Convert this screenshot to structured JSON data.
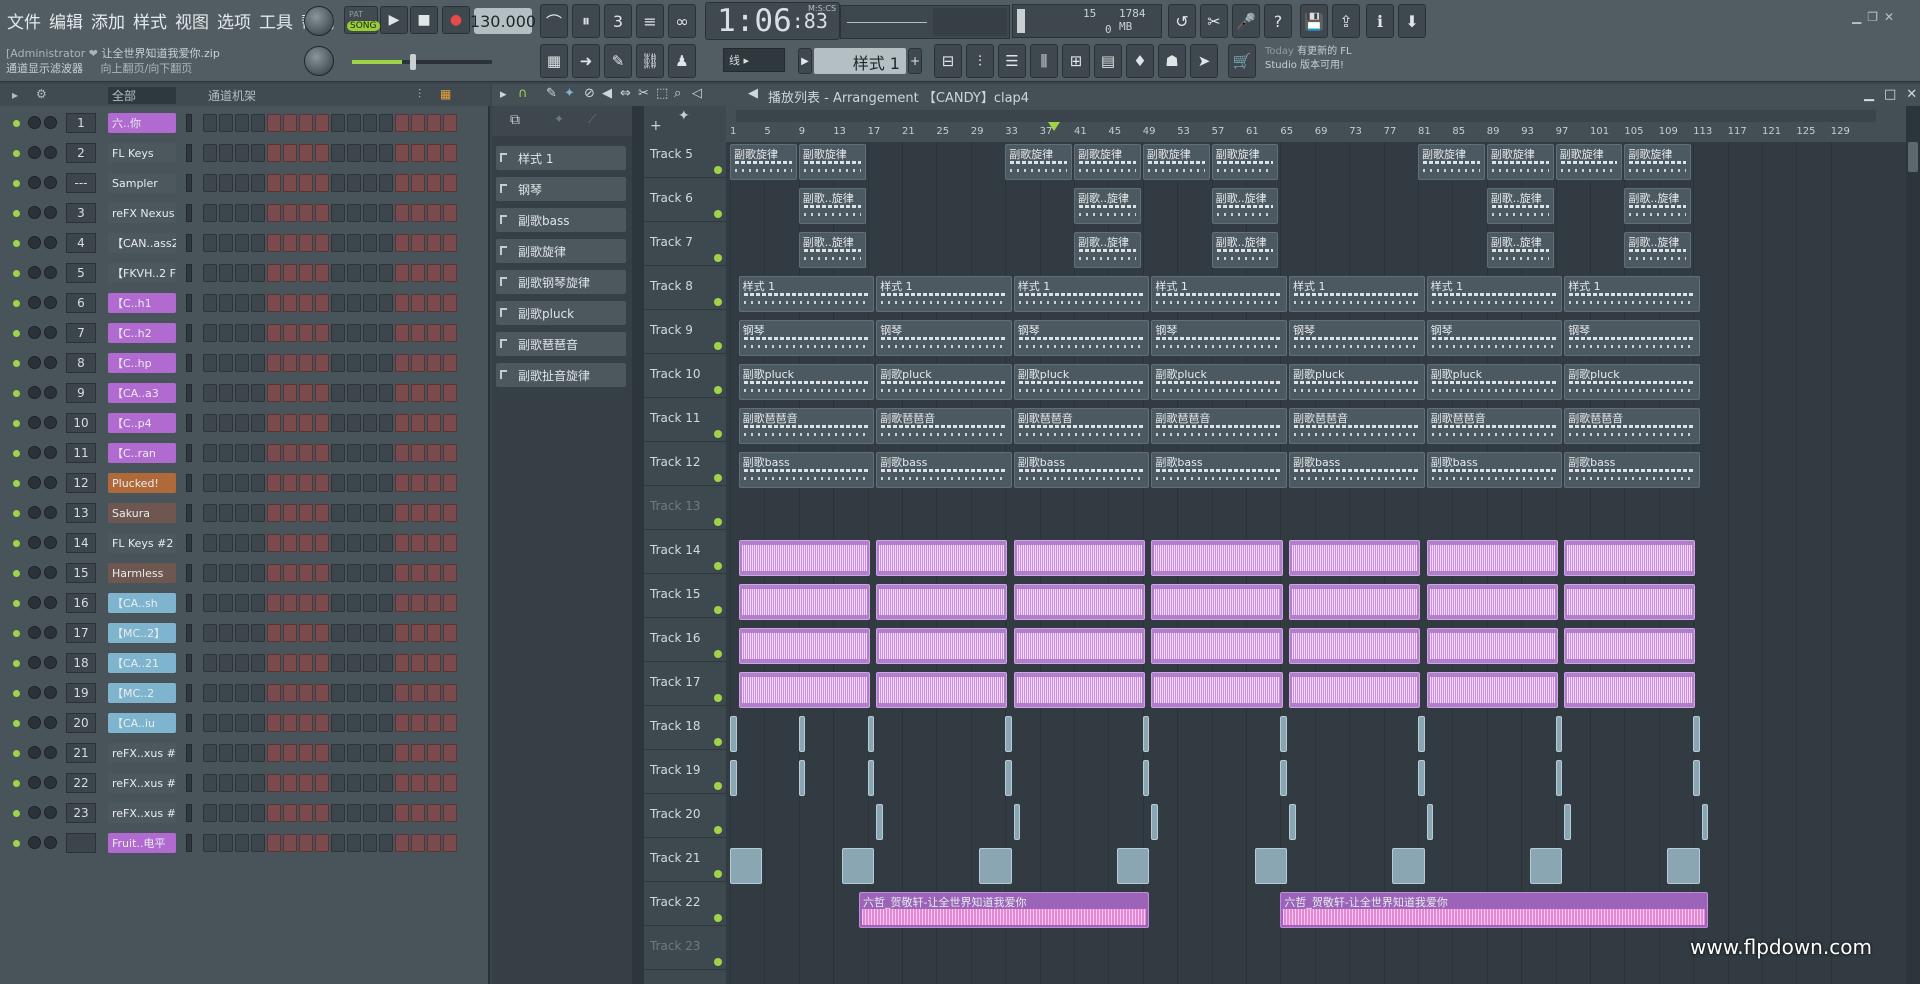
{
  "menu": [
    "文件",
    "编辑",
    "添加",
    "样式",
    "视图",
    "选项",
    "工具",
    "帮助"
  ],
  "hint": {
    "user": "[Administrator ❤",
    "file": "让全世界知道我爱你.zip",
    "line1": "通道显示滤波器",
    "line2": "向上翻页/向下翻页"
  },
  "transport": {
    "pat_label": "PAT",
    "song_label": "SONG",
    "tempo": "130.000",
    "time_main": "1:06",
    "time_sub": ":83",
    "time_unit": "M:S:CS"
  },
  "cpu": {
    "voices": "15",
    "mem": "1784 MB",
    "zero": "0"
  },
  "snap": "线",
  "pattern": "样式 1",
  "news": {
    "today": "Today",
    "line1": "有更新的 FL",
    "line2": "Studio 版本可用!"
  },
  "rack": {
    "filter": "全部",
    "title": "通道机架"
  },
  "channels": [
    {
      "num": "1",
      "name": "六..你",
      "color": "purple"
    },
    {
      "num": "2",
      "name": "FL Keys",
      "color": "dark"
    },
    {
      "num": "---",
      "name": "Sampler",
      "color": "dark"
    },
    {
      "num": "3",
      "name": "reFX Nexus",
      "color": "dark"
    },
    {
      "num": "4",
      "name": "【CAN..ass2",
      "color": "dark"
    },
    {
      "num": "5",
      "name": "【FKVH..2 F",
      "color": "dark"
    },
    {
      "num": "6",
      "name": "【C..h1",
      "color": "purple"
    },
    {
      "num": "7",
      "name": "【C..h2",
      "color": "purple"
    },
    {
      "num": "8",
      "name": "【C..hp",
      "color": "purple"
    },
    {
      "num": "9",
      "name": "【CA..a3",
      "color": "purple"
    },
    {
      "num": "10",
      "name": "【C..p4",
      "color": "purple"
    },
    {
      "num": "11",
      "name": "【C..ran",
      "color": "purple"
    },
    {
      "num": "12",
      "name": "Plucked!",
      "color": "orange"
    },
    {
      "num": "13",
      "name": "Sakura",
      "color": "brown"
    },
    {
      "num": "14",
      "name": "FL Keys #2",
      "color": "dark"
    },
    {
      "num": "15",
      "name": "Harmless",
      "color": "brown"
    },
    {
      "num": "16",
      "name": "【CA..sh",
      "color": "blue"
    },
    {
      "num": "17",
      "name": "【MC..2】",
      "color": "blue"
    },
    {
      "num": "18",
      "name": "【CA..21",
      "color": "blue"
    },
    {
      "num": "19",
      "name": "【MC..2",
      "color": "blue"
    },
    {
      "num": "20",
      "name": "【CA..iu",
      "color": "blue"
    },
    {
      "num": "21",
      "name": "reFX..xus #2",
      "color": "dark"
    },
    {
      "num": "22",
      "name": "reFX..xus #3",
      "color": "dark"
    },
    {
      "num": "23",
      "name": "reFX..xus #4",
      "color": "dark"
    },
    {
      "num": "",
      "name": "Fruit..电平",
      "color": "purple"
    }
  ],
  "playlist": {
    "title": "播放列表 - Arrangement  【CANDY】clap4"
  },
  "patterns": [
    "样式 1",
    "钢琴",
    "副歌bass",
    "副歌旋律",
    "副歌钢琴旋律",
    "副歌pluck",
    "副歌琶琶音",
    "副歌扯音旋律"
  ],
  "ruler": [
    "1",
    "5",
    "9",
    "13",
    "17",
    "21",
    "25",
    "29",
    "33",
    "37",
    "41",
    "45",
    "49",
    "53",
    "57",
    "61",
    "65",
    "69",
    "73",
    "77",
    "81",
    "85",
    "89",
    "93",
    "97",
    "101",
    "105",
    "109",
    "113",
    "117",
    "121",
    "125",
    "129"
  ],
  "tracks": [
    "Track 5",
    "Track 6",
    "Track 7",
    "Track 8",
    "Track 9",
    "Track 10",
    "Track 11",
    "Track 12",
    "Track 13",
    "Track 14",
    "Track 15",
    "Track 16",
    "Track 17",
    "Track 18",
    "Track 19",
    "Track 20",
    "Track 21",
    "Track 22",
    "Track 23"
  ],
  "clip_names": {
    "melody": "副歌旋律",
    "melody2": "副歌..旋律",
    "pattern1": "样式 1",
    "piano": "钢琴",
    "pluck": "副歌pluck",
    "arp": "副歌琶琶音",
    "bass": "副歌bass",
    "song": "六哲_贺敬轩-让全世界知道我爱你"
  },
  "watermark": "www.flpdown.com",
  "colors": {
    "accent_green": "#9fd44a",
    "clip_purple": "#b07fc9",
    "pattern_clip": "#4d5960"
  }
}
